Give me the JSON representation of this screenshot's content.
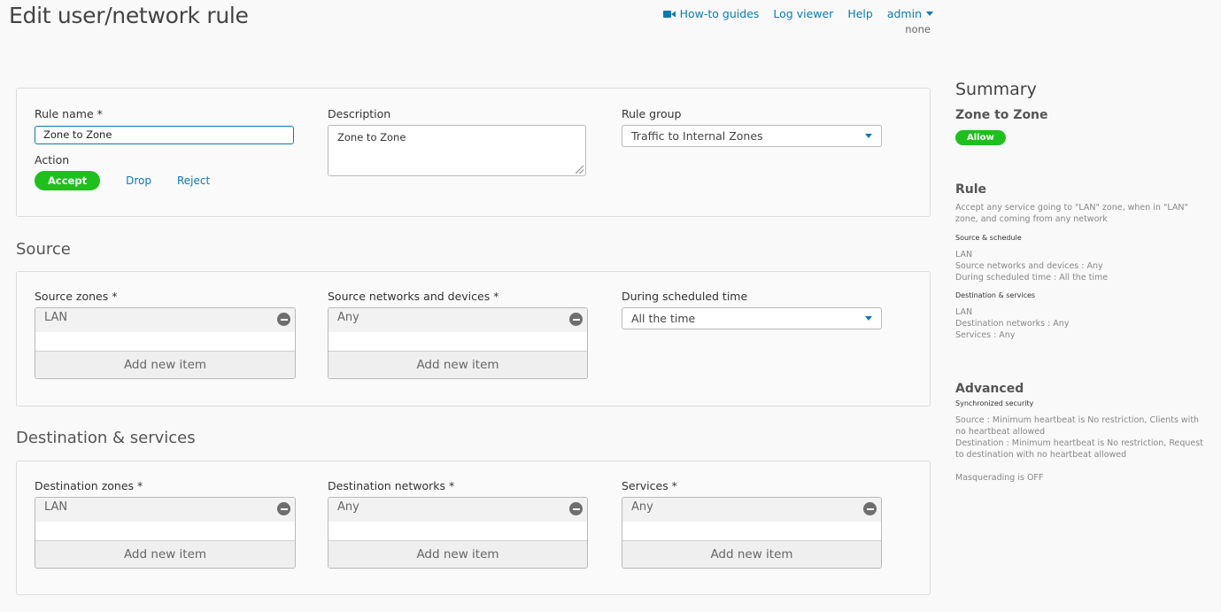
{
  "page": {
    "title": "Edit user/network rule"
  },
  "topnav": {
    "howto": "How-to guides",
    "logviewer": "Log viewer",
    "help": "Help",
    "user": "admin",
    "device": "none"
  },
  "colors": {
    "accent": "#0a7ab5",
    "success": "#1ec01e"
  },
  "rule": {
    "name_label": "Rule name *",
    "name_value": "Zone to Zone",
    "description_label": "Description",
    "description_value": "Zone to Zone",
    "group_label": "Rule group",
    "group_value": "Traffic to Internal Zones",
    "action_label": "Action",
    "actions": [
      "Accept",
      "Drop",
      "Reject"
    ]
  },
  "source": {
    "title": "Source",
    "zones_label": "Source zones *",
    "zones_item": "LAN",
    "networks_label": "Source networks and devices *",
    "networks_item": "Any",
    "schedule_label": "During scheduled time",
    "schedule_value": "All the time",
    "add_label": "Add new item"
  },
  "destination": {
    "title": "Destination & services",
    "zones_label": "Destination zones *",
    "zones_item": "LAN",
    "networks_label": "Destination networks *",
    "networks_item": "Any",
    "services_label": "Services *",
    "services_item": "Any",
    "add_label": "Add new item"
  },
  "summary": {
    "title": "Summary",
    "rule_name": "Zone to Zone",
    "badge": "Allow",
    "rule_heading": "Rule",
    "rule_text": "Accept any service going to \"LAN\" zone, when in \"LAN\" zone, and coming from any network",
    "src_heading": "Source & schedule",
    "src_lines": [
      "LAN",
      "Source networks and devices : Any",
      "During scheduled time : All the time"
    ],
    "dst_heading": "Destination & services",
    "dst_lines": [
      "LAN",
      "Destination networks : Any",
      "Services : Any"
    ],
    "adv_heading": "Advanced",
    "sync_heading": "Synchronized security",
    "sync_source": "Source : Minimum heartbeat is No restriction, Clients with no heartbeat allowed",
    "sync_dest": "Destination : Minimum heartbeat is No restriction, Request to destination with no heartbeat allowed",
    "masq": "Masquerading is OFF"
  }
}
